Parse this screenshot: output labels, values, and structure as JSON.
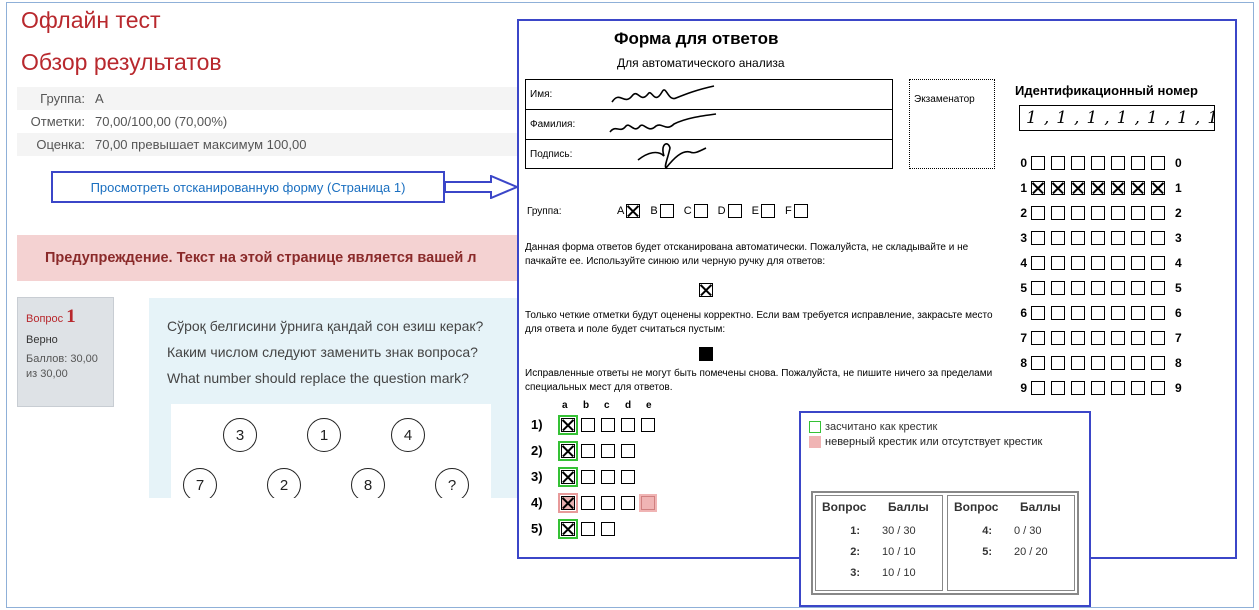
{
  "page": {
    "title": "Офлайн тест",
    "subtitle": "Обзор результатов"
  },
  "summary": [
    {
      "label": "Группа:",
      "value": "A"
    },
    {
      "label": "Отметки:",
      "value": "70,00/100,00 (70,00%)"
    },
    {
      "label": "Оценка:",
      "value": "70,00 превышает максимум 100,00"
    }
  ],
  "scan_link": "Просмотреть отсканированную форму (Страница 1)",
  "warning": "Предупреждение. Текст на этой странице является вашей л",
  "question_info": {
    "label": "Вопрос",
    "number": "1",
    "state": "Верно",
    "points": "Баллов: 30,00 из 30,00"
  },
  "question": {
    "lines": [
      "Сўроқ белгисини ўрнига қандай сон езиш керак?",
      "Каким числом следуют заменить знак вопроса?",
      "What number should replace the question mark?"
    ],
    "circles_top": [
      "3",
      "1",
      "4"
    ],
    "circles_bottom": [
      "7",
      "2",
      "8",
      "?"
    ]
  },
  "form": {
    "title": "Форма для ответов",
    "subtitle": "Для автоматического анализа",
    "name_label": "Имя:",
    "surname_label": "Фамилия:",
    "signature_label": "Подпись:",
    "examiner_label": "Экзаменатор",
    "id_title": "Идентификационный номер",
    "id_written": "1,1,1,1,1,1,1",
    "id_digits": [
      "0",
      "1",
      "2",
      "3",
      "4",
      "5",
      "6",
      "7",
      "8",
      "9"
    ],
    "id_marked_row": "1",
    "group_label": "Группа:",
    "group_options": [
      "A",
      "B",
      "C",
      "D",
      "E",
      "F"
    ],
    "group_selected": "A",
    "para1": "Данная форма ответов будет отсканирована автоматически. Пожалуйста, не складывайте и не пачкайте ее. Используйте синюю или черную ручку для ответов:",
    "para2": "Только четкие отметки будут оценены корректно. Если вам требуется исправление, закрасьте место для ответа и поле будет считаться пустым:",
    "para3": "Исправленные ответы не могут быть помечены снова. Пожалуйста, не пишите ничего за пределами специальных мест для ответов.",
    "answer_columns": [
      "a",
      "b",
      "c",
      "d",
      "e"
    ],
    "answer_rows": [
      "1)",
      "2)",
      "3)",
      "4)",
      "5)"
    ]
  },
  "legend": {
    "ok": "засчитано как крестик",
    "bad": "неверный крестик или отсутствует крестик",
    "col_question": "Вопрос",
    "col_points": "Баллы",
    "left": [
      {
        "q": "1:",
        "s": "30 / 30"
      },
      {
        "q": "2:",
        "s": "10 / 10"
      },
      {
        "q": "3:",
        "s": "10 / 10"
      }
    ],
    "right": [
      {
        "q": "4:",
        "s": "0 / 30"
      },
      {
        "q": "5:",
        "s": "20 / 20"
      }
    ]
  },
  "colors": {
    "title_red": "#b8282d",
    "link_blue": "#1a6fc0",
    "annotation_blue": "#3b46c8",
    "ok_green": "#35c135",
    "bad_pink": "#f0b4b4"
  }
}
